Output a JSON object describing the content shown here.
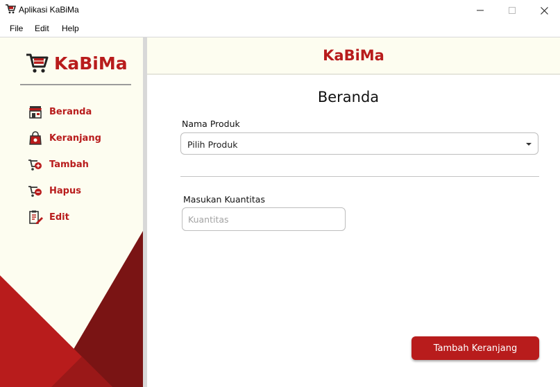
{
  "window": {
    "title": "Aplikasi KaBiMa",
    "controls": [
      "minimize-icon",
      "maximize-icon",
      "close-icon"
    ]
  },
  "menubar": {
    "items": [
      "File",
      "Edit",
      "Help"
    ]
  },
  "sidebar": {
    "brand": "KaBiMa",
    "items": [
      {
        "label": "Beranda",
        "icon": "store-icon"
      },
      {
        "label": "Keranjang",
        "icon": "shopping-bag-icon"
      },
      {
        "label": "Tambah",
        "icon": "cart-add-icon"
      },
      {
        "label": "Hapus",
        "icon": "cart-remove-icon"
      },
      {
        "label": "Edit",
        "icon": "edit-clipboard-icon"
      }
    ]
  },
  "header": {
    "title": "KaBiMa"
  },
  "main": {
    "page_title": "Beranda",
    "product_label": "Nama Produk",
    "product_select_value": "Pilih Produk",
    "quantity_label": "Masukan Kuantitas",
    "quantity_placeholder": "Kuantitas",
    "quantity_value": "",
    "submit_label": "Tambah Keranjang"
  },
  "colors": {
    "accent": "#b81c1c",
    "accent_dark": "#7a1414",
    "sidebar_bg": "#fdfdf0"
  }
}
